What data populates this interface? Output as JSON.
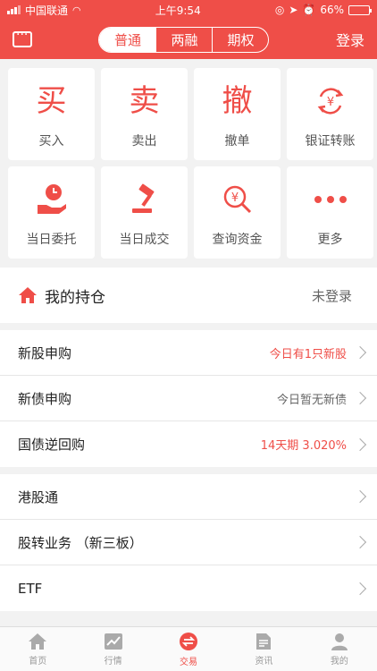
{
  "status": {
    "carrier": "中国联通",
    "time": "上午9:54",
    "battery": "66%",
    "battery_level": 0.66
  },
  "header": {
    "tabs": [
      {
        "label": "普通"
      },
      {
        "label": "两融"
      },
      {
        "label": "期权"
      }
    ],
    "login": "登录"
  },
  "grid": [
    {
      "label": "买入",
      "glyph": "买"
    },
    {
      "label": "卖出",
      "glyph": "卖"
    },
    {
      "label": "撤单",
      "glyph": "撤"
    },
    {
      "label": "银证转账"
    },
    {
      "label": "当日委托"
    },
    {
      "label": "当日成交"
    },
    {
      "label": "查询资金"
    },
    {
      "label": "更多"
    }
  ],
  "holdings": {
    "title": "我的持仓",
    "status": "未登录"
  },
  "group1": [
    {
      "name": "新股申购",
      "info": "今日有1只新股"
    },
    {
      "name": "新债申购",
      "info": "今日暂无新债"
    },
    {
      "name": "国债逆回购",
      "info": "14天期 3.020%"
    }
  ],
  "group2": [
    {
      "name": "港股通"
    },
    {
      "name": "股转业务 （新三板）"
    },
    {
      "name": "ETF"
    }
  ],
  "tabbar": [
    {
      "label": "首页"
    },
    {
      "label": "行情"
    },
    {
      "label": "交易"
    },
    {
      "label": "资讯"
    },
    {
      "label": "我的"
    }
  ],
  "colors": {
    "accent": "#ef4e48"
  }
}
